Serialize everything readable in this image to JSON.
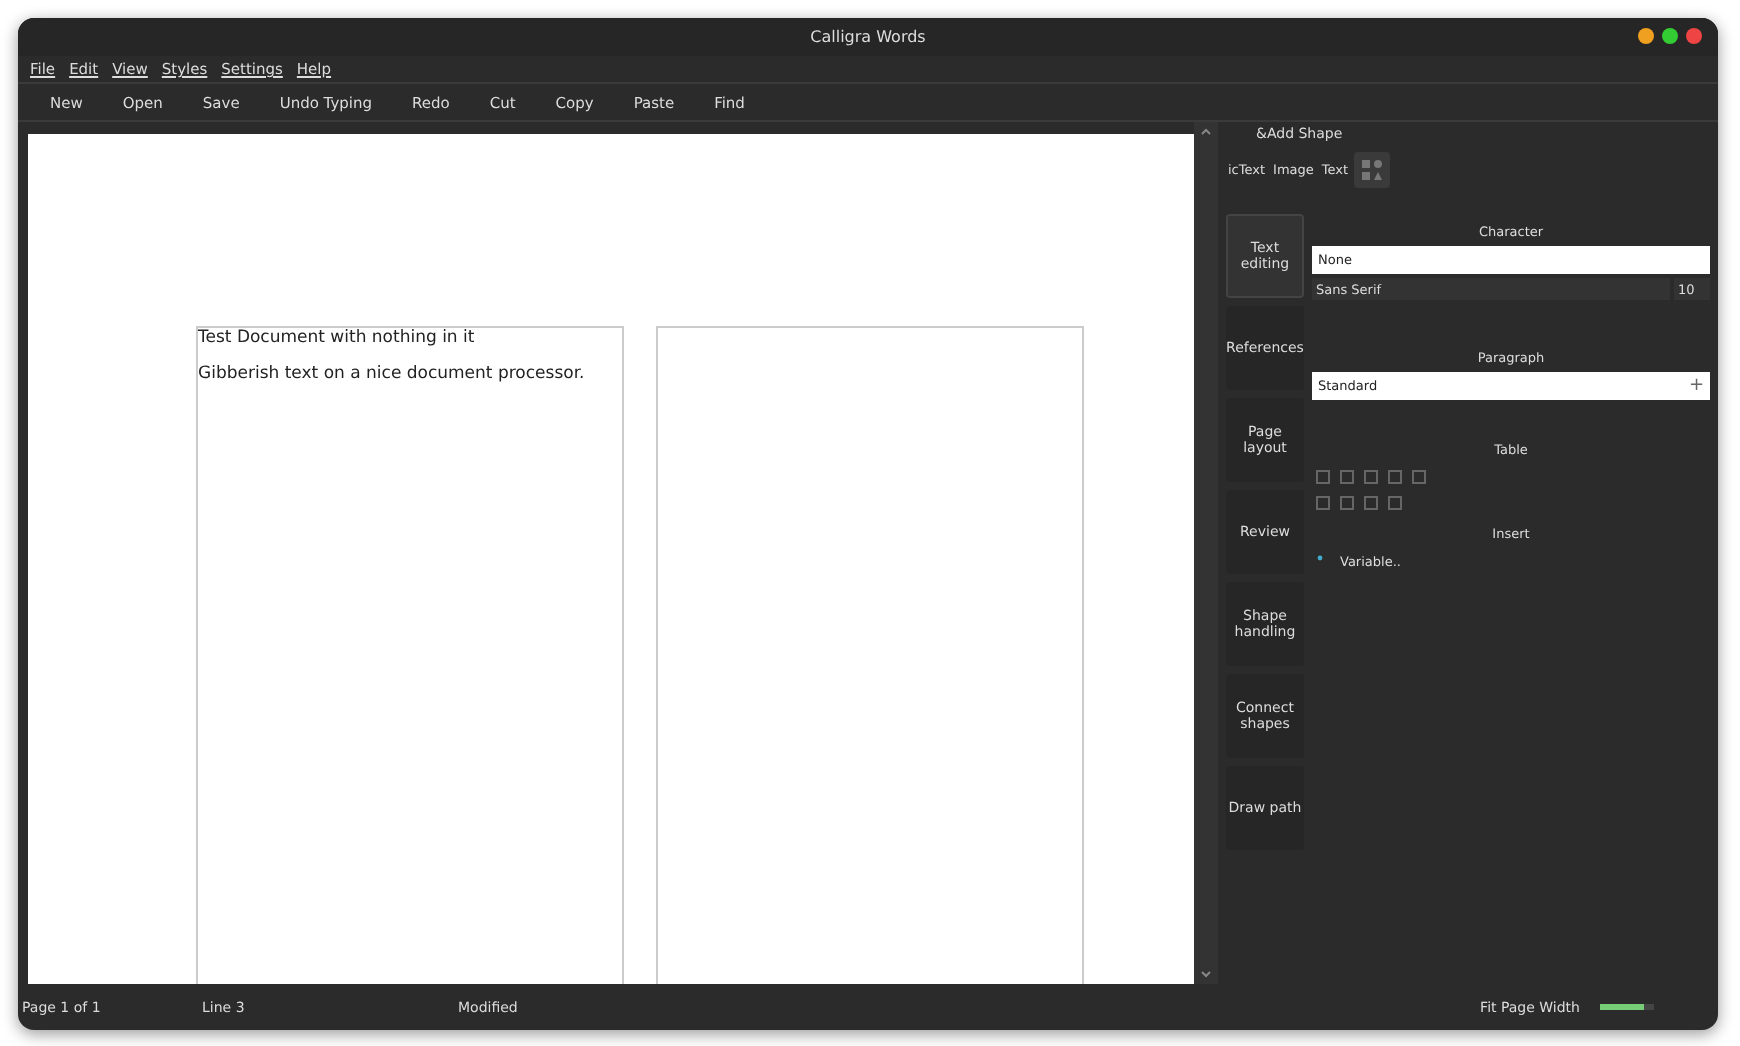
{
  "window": {
    "title": "Calligra Words"
  },
  "menu": [
    "File",
    "Edit",
    "View",
    "Styles",
    "Settings",
    "Help"
  ],
  "toolbar": [
    "New",
    "Open",
    "Save",
    "Undo Typing",
    "Redo",
    "Cut",
    "Copy",
    "Paste",
    "Find"
  ],
  "document": {
    "pages": [
      {
        "kind": "text",
        "lines": [
          "Test Document with nothing in it",
          "Gibberish text on a nice document processor."
        ]
      },
      {
        "kind": "blank"
      }
    ]
  },
  "docker": {
    "title": "&Add Shape",
    "shapes": [
      "icText",
      "Image",
      "Text"
    ],
    "tabs": [
      {
        "label": "Text editing",
        "selected": true
      },
      {
        "label": "References",
        "selected": false
      },
      {
        "label": "Page layout",
        "selected": false
      },
      {
        "label": "Review",
        "selected": false
      },
      {
        "label": "Shape handling",
        "selected": false
      },
      {
        "label": "Connect shapes",
        "selected": false
      },
      {
        "label": "Draw path",
        "selected": false
      }
    ],
    "character": {
      "title": "Character",
      "style": "None",
      "font": "Sans Serif",
      "size": "10"
    },
    "paragraph": {
      "title": "Paragraph",
      "style": "Standard",
      "add": "+"
    },
    "table": {
      "title": "Table"
    },
    "insert": {
      "title": "Insert",
      "variable": "Variable.."
    }
  },
  "status_bar": {
    "page": "Page 1 of 1",
    "line": "Line 3",
    "state": "Modified",
    "zoom": "Fit Page Width",
    "zoom_slider": {
      "level": 0.8
    }
  }
}
